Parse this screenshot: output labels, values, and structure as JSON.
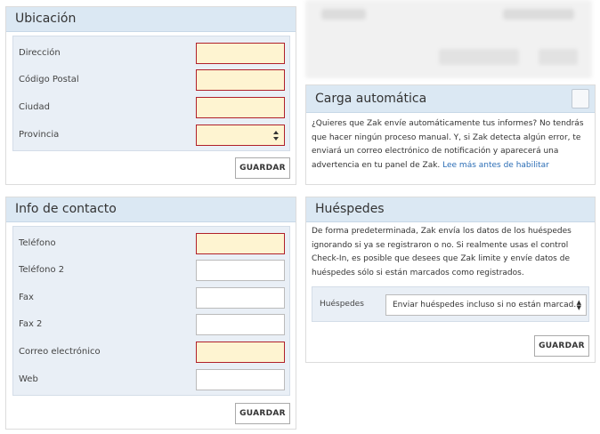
{
  "ubicacion": {
    "title": "Ubicación",
    "fields": [
      {
        "label": "Dirección",
        "value": ""
      },
      {
        "label": "Código Postal",
        "value": ""
      },
      {
        "label": "Ciudad",
        "value": ""
      },
      {
        "label": "Provincia",
        "value": ""
      }
    ],
    "save_label": "GUARDAR"
  },
  "contacto": {
    "title": "Info de contacto",
    "fields": [
      {
        "label": "Teléfono",
        "value": ""
      },
      {
        "label": "Teléfono 2",
        "value": ""
      },
      {
        "label": "Fax",
        "value": ""
      },
      {
        "label": "Fax 2",
        "value": ""
      },
      {
        "label": "Correo electrónico",
        "value": ""
      },
      {
        "label": "Web",
        "value": ""
      }
    ],
    "save_label": "GUARDAR"
  },
  "carga": {
    "title": "Carga automática",
    "description": "¿Quieres que Zak envíe automáticamente tus informes? No tendrás que hacer ningún proceso manual. Y, si Zak detecta algún error, te enviará un correo electrónico de notificación y aparecerá una advertencia en tu panel de Zak. ",
    "link": "Lee más antes de habilitar"
  },
  "huespedes": {
    "title": "Huéspedes",
    "description": "De forma predeterminada, Zak envía los datos de los huéspedes ignorando si ya se registraron o no. Si realmente usas el control Check-In, es posible que desees que Zak limite y envíe datos de huéspedes sólo si están marcados como registrados.",
    "select_label": "Huéspedes",
    "select_value": "Enviar huéspedes incluso si no están marcad…",
    "save_label": "GUARDAR"
  },
  "colors": {
    "header_bg": "#dbe8f3",
    "required_bg": "#fef4d1",
    "required_border": "#b0202a",
    "link": "#2c6eb6"
  }
}
